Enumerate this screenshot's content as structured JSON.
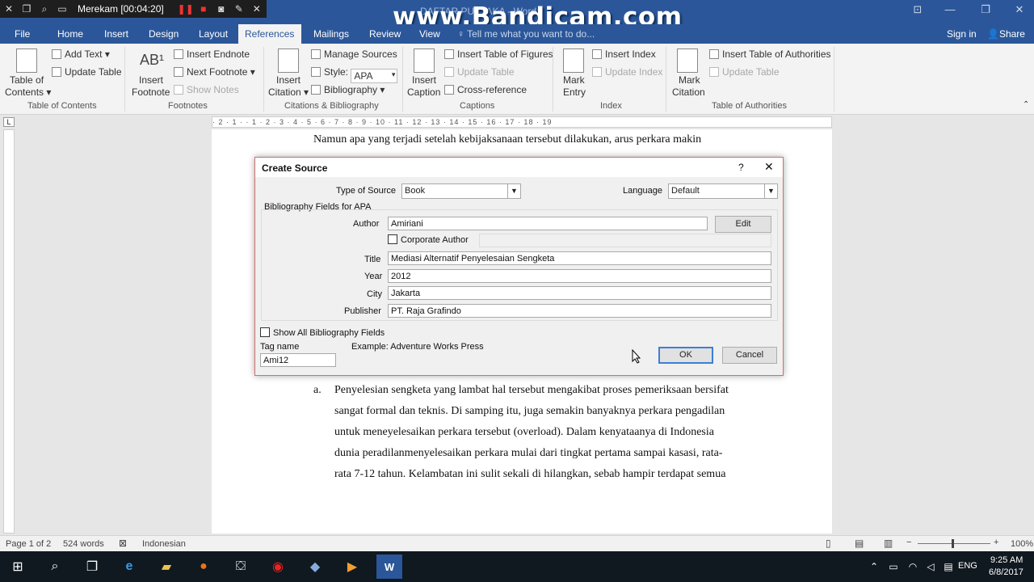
{
  "recorder": {
    "status": "Merekam [00:04:20]"
  },
  "window": {
    "doc_title": "DAFTAR PUSTAKA - Word",
    "watermark": "www.Bandicam.com"
  },
  "menu": {
    "tabs": [
      "File",
      "Home",
      "Insert",
      "Design",
      "Layout",
      "References",
      "Mailings",
      "Review",
      "View"
    ],
    "active": "References",
    "tell_me": "Tell me what you want to do...",
    "sign_in": "Sign in",
    "share": "Share"
  },
  "ribbon": {
    "toc": {
      "add_text": "Add Text",
      "update_table": "Update Table",
      "toc_line1": "Table of",
      "toc_line2": "Contents",
      "label": "Table of Contents"
    },
    "footnotes": {
      "insert_line1": "Insert",
      "insert_line2": "Footnote",
      "insert_endnote": "Insert Endnote",
      "next_footnote": "Next Footnote",
      "show_notes": "Show Notes",
      "label": "Footnotes"
    },
    "citations": {
      "insert_line1": "Insert",
      "insert_line2": "Citation",
      "manage_sources": "Manage Sources",
      "style_label": "Style:",
      "style_value": "APA",
      "bibliography": "Bibliography",
      "label": "Citations & Bibliography"
    },
    "captions": {
      "insert_line1": "Insert",
      "insert_line2": "Caption",
      "insert_tof": "Insert Table of Figures",
      "update_table": "Update Table",
      "cross_ref": "Cross-reference",
      "label": "Captions"
    },
    "index": {
      "mark_line1": "Mark",
      "mark_line2": "Entry",
      "insert_index": "Insert Index",
      "update_index": "Update Index",
      "label": "Index"
    },
    "toa": {
      "mark_line1": "Mark",
      "mark_line2": "Citation",
      "insert_toa": "Insert Table of Authorities",
      "update_table": "Update Table",
      "label": "Table of Authorities"
    }
  },
  "ruler": {
    "marks": "· 2 · 1 ·  · 1 · 2 · 3 · 4 · 5 · 6 · 7 · 8 · 9 · 10 · 11 · 12 · 13 · 14 · 15 · 16 · 17 · 18 · 19"
  },
  "document": {
    "top_line": "Namun apa yang terjadi setelah kebijaksanaan tersebut dilakukan, arus perkara makin",
    "list_marker": "a.",
    "lines": [
      "Penyelesian sengketa yang lambat hal tersebut mengakibat proses pemeriksaan bersifat",
      "sangat formal dan teknis. Di samping itu, juga semakin banyaknya perkara pengadilan",
      "untuk meneyelesaikan perkara tersebut (overload). Dalam kenyataanya di Indonesia",
      "dunia peradilanmenyelesaikan perkara mulai dari tingkat pertama sampai kasasi, rata-",
      "rata 7-12 tahun. Kelambatan ini sulit sekali di hilangkan, sebab hampir terdapat semua"
    ]
  },
  "dialog": {
    "title": "Create Source",
    "help": "?",
    "type_label": "Type of Source",
    "type_value": "Book",
    "language_label": "Language",
    "language_value": "Default",
    "fields_header": "Bibliography Fields for APA",
    "author_label": "Author",
    "author_value": "Amiriani",
    "edit_button": "Edit",
    "corporate_label": "Corporate Author",
    "title_label": "Title",
    "title_value": "Mediasi Alternatif Penyelesaian Sengketa",
    "year_label": "Year",
    "year_value": "2012",
    "city_label": "City",
    "city_value": "Jakarta",
    "publisher_label": "Publisher",
    "publisher_value": "PT. Raja Grafindo",
    "show_all_label": "Show All Bibliography Fields",
    "tag_label": "Tag name",
    "tag_value": "Ami12",
    "example_text": "Example: Adventure Works Press",
    "ok": "OK",
    "cancel": "Cancel"
  },
  "status": {
    "page": "Page 1 of 2",
    "words": "524 words",
    "language": "Indonesian",
    "zoom": "100%"
  },
  "taskbar": {
    "lang": "ENG",
    "time": "9:25 AM",
    "date": "6/8/2017"
  },
  "colors": {
    "word_blue": "#2b579a",
    "dialog_border": "#d07070"
  }
}
